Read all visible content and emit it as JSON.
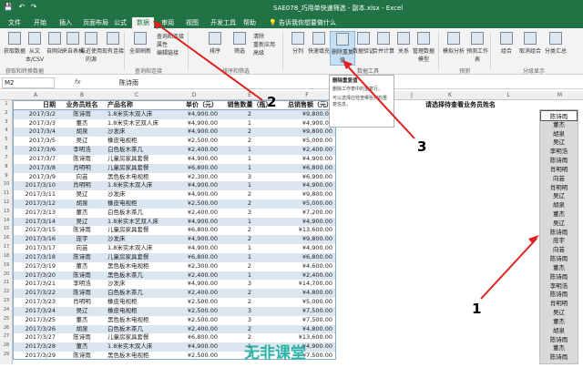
{
  "window": {
    "title": "SAE078_巧用单快速筛选 - 副本.xlsx  -  Excel"
  },
  "menu": [
    "文件",
    "开始",
    "插入",
    "页面布局",
    "公式",
    "数据",
    "审阅",
    "视图",
    "开发工具",
    "帮助",
    "告诉我你想要做什么"
  ],
  "ribbon": {
    "buttons": [
      "获取数据",
      "从文本/CSV",
      "自网站",
      "来自表格",
      "最近使用的源",
      "现有连接",
      "全部刷新",
      "排序",
      "筛选",
      "分列",
      "快速填充",
      "删除重复值",
      "数据验证",
      "合并计算",
      "关系",
      "管理数据模型",
      "模拟分析",
      "预测工作表",
      "组合",
      "取消组合",
      "分类汇总"
    ],
    "small": [
      "查询和连接",
      "属性",
      "编辑链接",
      "清除",
      "重新应用",
      "高级"
    ],
    "groups": [
      "获取和转换数据",
      "查询和连接",
      "排序和筛选",
      "数据工具",
      "预测",
      "分级显示"
    ]
  },
  "tooltip": {
    "title": "删除重复值",
    "lines": [
      "删除工作表中的重复行。",
      "可以选择应检查哪些列的重复信息。"
    ]
  },
  "formula": {
    "name_box": "M2",
    "fx": "fx",
    "content": "陈诗雨"
  },
  "columns": [
    "A",
    "B",
    "C",
    "D",
    "E",
    "F",
    "G",
    "H",
    "I",
    "J",
    "K",
    "L",
    "M"
  ],
  "table": {
    "headers": [
      "日期",
      "业务员姓名",
      "产品名称",
      "单价（元）",
      "销售数量（瓶）",
      "总销售额（元）"
    ],
    "rows": [
      [
        "2017/3/2",
        "陈诗雨",
        "1.8米实木双人床",
        "¥4,900.00",
        "2",
        "¥9,800.00"
      ],
      [
        "2017/3/3",
        "董杰",
        "1.8米实木艺双人床",
        "¥4,900.00",
        "1",
        "¥4,900.00"
      ],
      [
        "2017/3/4",
        "胡泉",
        "沙发床",
        "¥4,900.00",
        "2",
        "¥9,800.00"
      ],
      [
        "2017/3/5",
        "吴辽",
        "橡皮电视柜",
        "¥2,500.00",
        "2",
        "¥5,000.00"
      ],
      [
        "2017/3/6",
        "李明浩",
        "白色板木茶几",
        "¥2,400.00",
        "1",
        "¥2,400.00"
      ],
      [
        "2017/3/7",
        "陈诗雨",
        "儿童房家具套餐",
        "¥4,900.00",
        "1",
        "¥4,900.00"
      ],
      [
        "2017/3/8",
        "肖明明",
        "儿童房家具套餐",
        "¥6,800.00",
        "1",
        "¥6,800.00"
      ],
      [
        "2017/3/9",
        "向芸",
        "黑色板木电视柜",
        "¥2,300.00",
        "3",
        "¥6,900.00"
      ],
      [
        "2017/3/10",
        "肖明明",
        "1.8米实木双人床",
        "¥4,900.00",
        "1",
        "¥4,900.00"
      ],
      [
        "2017/3/11",
        "吴辽",
        "沙发床",
        "¥4,900.00",
        "2",
        "¥9,800.00"
      ],
      [
        "2017/3/12",
        "胡泉",
        "橡皮电视柜",
        "¥2,500.00",
        "2",
        "¥5,000.00"
      ],
      [
        "2017/3/13",
        "董杰",
        "白色板木茶几",
        "¥2,400.00",
        "3",
        "¥7,200.00"
      ],
      [
        "2017/3/14",
        "吴辽",
        "1.8米实木艺双人床",
        "¥4,900.00",
        "1",
        "¥4,900.00"
      ],
      [
        "2017/3/15",
        "陈诗雨",
        "儿童房家具套餐",
        "¥6,800.00",
        "2",
        "¥13,600.00"
      ],
      [
        "2017/3/16",
        "庞宇",
        "沙发床",
        "¥4,900.00",
        "2",
        "¥9,800.00"
      ],
      [
        "2017/3/17",
        "向芸",
        "1.8米实木双人床",
        "¥4,900.00",
        "1",
        "¥4,900.00"
      ],
      [
        "2017/3/18",
        "陈诗雨",
        "儿童房家具套餐",
        "¥6,800.00",
        "1",
        "¥6,800.00"
      ],
      [
        "2017/3/19",
        "董杰",
        "黑色板木电视柜",
        "¥2,300.00",
        "2",
        "¥4,600.00"
      ],
      [
        "2017/3/20",
        "陈诗雨",
        "黑色板木茶几",
        "¥2,400.00",
        "1",
        "¥2,400.00"
      ],
      [
        "2017/3/21",
        "李明浩",
        "沙发床",
        "¥4,900.00",
        "3",
        "¥14,700.00"
      ],
      [
        "2017/3/22",
        "陈诗雨",
        "白色板木茶几",
        "¥2,400.00",
        "2",
        "¥4,800.00"
      ],
      [
        "2017/3/23",
        "肖明明",
        "橡皮电视柜",
        "¥2,500.00",
        "2",
        "¥5,000.00"
      ],
      [
        "2017/3/24",
        "吴辽",
        "橡皮电视柜",
        "¥2,500.00",
        "3",
        "¥7,500.00"
      ],
      [
        "2017/3/25",
        "董杰",
        "黑色板木电视柜",
        "¥2,500.00",
        "3",
        "¥7,500.00"
      ],
      [
        "2017/3/26",
        "胡泉",
        "白色板木茶几",
        "¥2,400.00",
        "2",
        "¥4,800.00"
      ],
      [
        "2017/3/27",
        "陈诗雨",
        "儿童房家具套餐",
        "¥6,800.00",
        "2",
        "¥13,600.00"
      ],
      [
        "2017/3/28",
        "董杰",
        "1.8米实木双人床",
        "¥4,900.00",
        "1",
        "¥4,900.00"
      ],
      [
        "2017/3/29",
        "陈诗雨",
        "黑色板木电视柜",
        "¥2,500.00",
        "3",
        "¥7,500.00"
      ]
    ]
  },
  "prompt": "请选择待查看业务员姓名",
  "name_list": [
    "陈诗雨",
    "董杰",
    "胡泉",
    "吴辽",
    "李明浩",
    "陈诗雨",
    "肖明明",
    "向芸",
    "肖明明",
    "吴辽",
    "胡泉",
    "董杰",
    "吴辽",
    "陈诗雨",
    "庞宇",
    "向芸",
    "陈诗雨",
    "董杰",
    "陈诗雨",
    "李明浩",
    "陈诗雨",
    "肖明明",
    "吴辽",
    "董杰",
    "胡泉",
    "陈诗雨",
    "董杰",
    "陈诗雨"
  ],
  "annotations": [
    "1",
    "2",
    "3"
  ],
  "watermark": "无非课堂",
  "colors": {
    "excel_green": "#217346",
    "table_band": "#dce6f1",
    "selection": "#c5dff5",
    "annotation_red": "#e02020",
    "list_bg": "#d9d9d9"
  }
}
